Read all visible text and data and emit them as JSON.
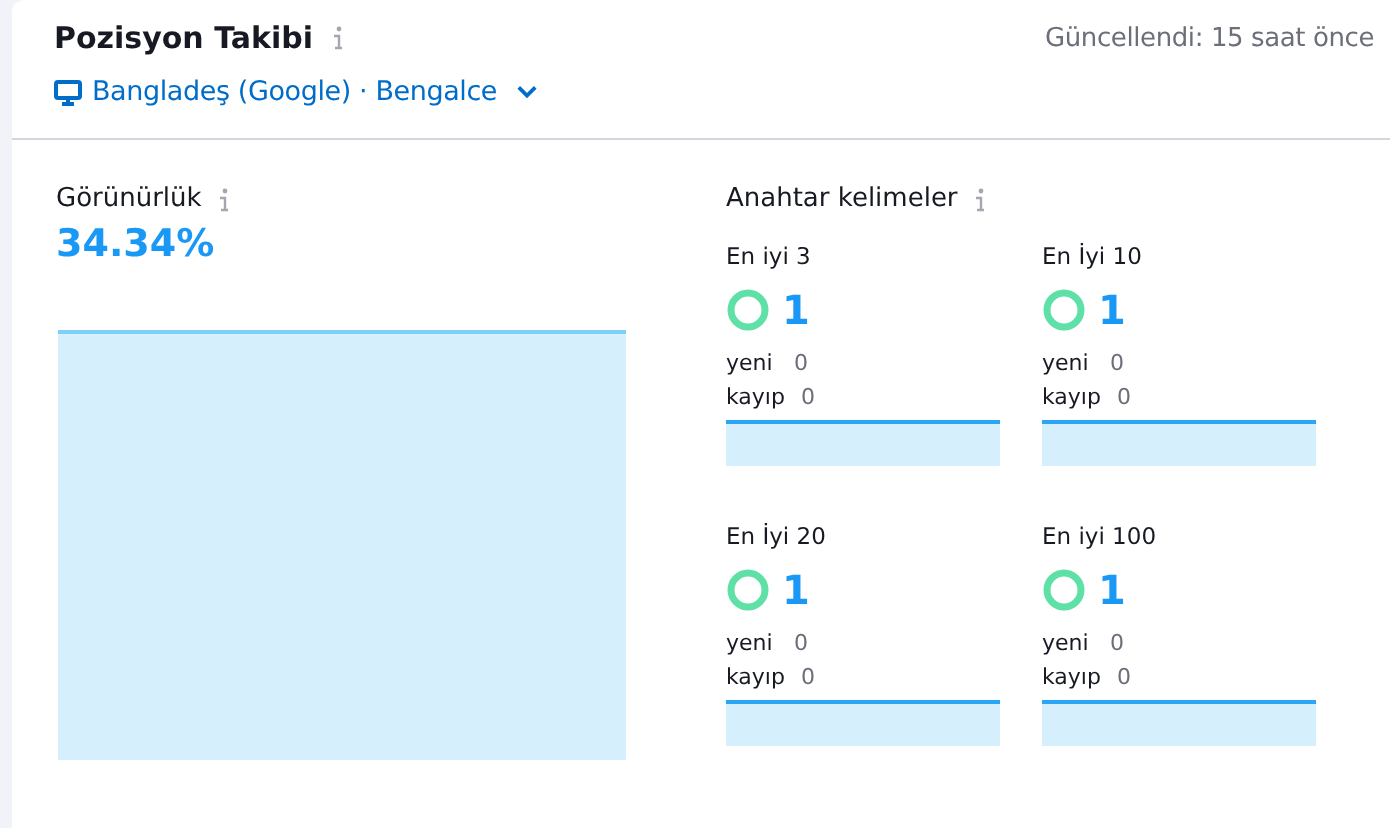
{
  "header": {
    "title": "Pozisyon Takibi",
    "updated": "Güncellendi: 15 saat önce",
    "location": "Bangladeş (Google) · Bengalce"
  },
  "visibility": {
    "label": "Görünürlük",
    "value": "34.34%"
  },
  "keywords": {
    "label": "Anahtar kelimeler",
    "groups": [
      {
        "label": "En iyi 3",
        "count": "1",
        "new_label": "yeni",
        "new_value": "0",
        "lost_label": "kayıp",
        "lost_value": "0"
      },
      {
        "label": "En İyi 10",
        "count": "1",
        "new_label": "yeni",
        "new_value": "0",
        "lost_label": "kayıp",
        "lost_value": "0"
      },
      {
        "label": "En İyi 20",
        "count": "1",
        "new_label": "yeni",
        "new_value": "0",
        "lost_label": "kayıp",
        "lost_value": "0"
      },
      {
        "label": "En iyi 100",
        "count": "1",
        "new_label": "yeni",
        "new_value": "0",
        "lost_label": "kayıp",
        "lost_value": "0"
      }
    ]
  }
}
